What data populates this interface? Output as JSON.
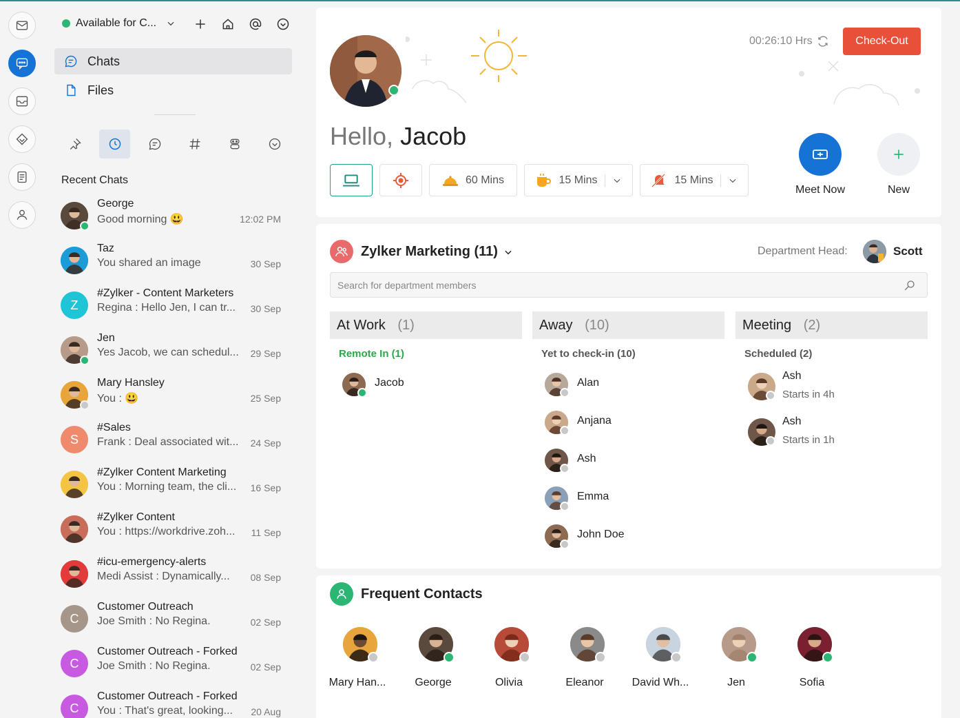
{
  "colors": {
    "accent": "#1673d6",
    "online": "#2bb673",
    "offline": "#c8c8c8",
    "checkout": "#e8503a",
    "selected_border": "#20a08a"
  },
  "rail": {
    "items": [
      "mail-icon",
      "chat-icon",
      "inbox-icon",
      "tags-icon",
      "document-icon",
      "user-icon"
    ],
    "active": "chat-icon"
  },
  "status": {
    "label": "Available for C..."
  },
  "nav": {
    "chats": "Chats",
    "files": "Files"
  },
  "filters": [
    "pin-icon",
    "clock-icon",
    "chat-bubble-icon",
    "hash-icon",
    "bot-icon",
    "chevron-down-icon"
  ],
  "recent": {
    "title": "Recent Chats",
    "items": [
      {
        "name": "George",
        "message": "Good morning 😃",
        "time": "12:02 PM",
        "initial": "",
        "color": "#5a4a3e",
        "presence": "online"
      },
      {
        "name": "Taz",
        "message": "You shared an image",
        "time": "30 Sep",
        "initial": "",
        "color": "#1b9bd8",
        "presence": ""
      },
      {
        "name": "#Zylker - Content Marketers",
        "message": "Regina : Hello Jen, I can tr...",
        "time": "30 Sep",
        "initial": "Z",
        "color": "#1fc5d6",
        "presence": ""
      },
      {
        "name": "Jen",
        "message": "Yes Jacob, we can schedul...",
        "time": "29 Sep",
        "initial": "",
        "color": "#b89a8a",
        "presence": "online"
      },
      {
        "name": "Mary Hansley",
        "message": "You : 😃",
        "time": "25 Sep",
        "initial": "",
        "color": "#e8a53c",
        "presence": "offline"
      },
      {
        "name": "#Sales",
        "message": "Frank : Deal associated wit...",
        "time": "24 Sep",
        "initial": "S",
        "color": "#f08a6c",
        "presence": ""
      },
      {
        "name": "#Zylker Content Marketing",
        "message": "You : Morning team, the cli...",
        "time": "16 Sep",
        "initial": "",
        "color": "#f4c542",
        "presence": ""
      },
      {
        "name": "#Zylker Content",
        "message": "You : https://workdrive.zoh...",
        "time": "11 Sep",
        "initial": "",
        "color": "#c86d5a",
        "presence": ""
      },
      {
        "name": "#icu-emergency-alerts",
        "message": "Medi Assist : Dynamically...",
        "time": "08 Sep",
        "initial": "",
        "color": "#e33b3b",
        "presence": ""
      },
      {
        "name": "Customer Outreach",
        "message": "Joe Smith : No Regina.",
        "time": "02 Sep",
        "initial": "C",
        "color": "#a69689",
        "presence": ""
      },
      {
        "name": "Customer Outreach - Forked",
        "message": "Joe Smith : No Regina.",
        "time": "02 Sep",
        "initial": "C",
        "color": "#c75ae0",
        "presence": ""
      },
      {
        "name": "Customer Outreach - Forked",
        "message": "You : That's great, looking...",
        "time": "20 Aug",
        "initial": "C",
        "color": "#c75ae0",
        "presence": ""
      }
    ]
  },
  "hero": {
    "greeting": "Hello,",
    "name": "Jacob",
    "timer": "00:26:10 Hrs",
    "checkout": "Check-Out",
    "pills": [
      {
        "icon": "laptop-icon",
        "label": ""
      },
      {
        "icon": "target-icon",
        "label": ""
      },
      {
        "icon": "food-cloche-icon",
        "label": "60 Mins"
      },
      {
        "icon": "coffee-icon",
        "label": "15 Mins"
      },
      {
        "icon": "mute-bell-icon",
        "label": "15 Mins"
      }
    ],
    "meet_now": "Meet Now",
    "new": "New"
  },
  "department": {
    "title": "Zylker Marketing (11)",
    "head_label": "Department Head:",
    "head_name": "Scott",
    "search_placeholder": "Search for department members",
    "columns": [
      {
        "title": "At Work",
        "count": "(1)",
        "subtitle": "Remote In (1)",
        "members": [
          {
            "name": "Jacob",
            "detail": "",
            "presence": "online"
          }
        ]
      },
      {
        "title": "Away",
        "count": "(10)",
        "subtitle": "Yet to check-in (10)",
        "members": [
          {
            "name": "Alan",
            "detail": "",
            "presence": "offline"
          },
          {
            "name": "Anjana",
            "detail": "",
            "presence": "offline"
          },
          {
            "name": "Ash",
            "detail": "",
            "presence": "offline"
          },
          {
            "name": "Emma",
            "detail": "",
            "presence": "offline"
          },
          {
            "name": "John Doe",
            "detail": "",
            "presence": "offline"
          }
        ]
      },
      {
        "title": "Meeting",
        "count": "(2)",
        "subtitle": "Scheduled (2)",
        "members": [
          {
            "name": "Ash",
            "detail": "Starts in 4h",
            "presence": "offline"
          },
          {
            "name": "Ash",
            "detail": "Starts in 1h",
            "presence": "offline"
          }
        ]
      }
    ]
  },
  "frequent": {
    "title": "Frequent Contacts",
    "contacts": [
      {
        "name": "Mary Han...",
        "presence": "offline"
      },
      {
        "name": "George",
        "presence": "online"
      },
      {
        "name": "Olivia",
        "presence": "offline"
      },
      {
        "name": "Eleanor",
        "presence": "offline"
      },
      {
        "name": "David Wh...",
        "presence": "offline"
      },
      {
        "name": "Jen",
        "presence": "online"
      },
      {
        "name": "Sofia",
        "presence": "online"
      }
    ]
  }
}
